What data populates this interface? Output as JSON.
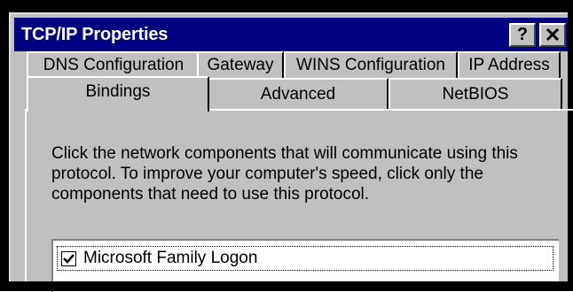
{
  "window": {
    "title": "TCP/IP Properties",
    "help_label": "?",
    "close_icon": "close-icon"
  },
  "tabs": {
    "back_row": [
      {
        "label": "DNS Configuration"
      },
      {
        "label": "Gateway"
      },
      {
        "label": "WINS Configuration"
      },
      {
        "label": "IP Address"
      }
    ],
    "front_row": [
      {
        "label": "Bindings",
        "selected": true
      },
      {
        "label": "Advanced"
      },
      {
        "label": "NetBIOS"
      }
    ]
  },
  "bindings": {
    "description": "Click the network components that will communicate using this protocol. To improve your computer's speed, click only the components that need to use this protocol.",
    "components": [
      {
        "label": "Microsoft Family Logon",
        "checked": true
      }
    ]
  },
  "colors": {
    "titlebar": "#000080",
    "face": "#c0c0c0"
  }
}
